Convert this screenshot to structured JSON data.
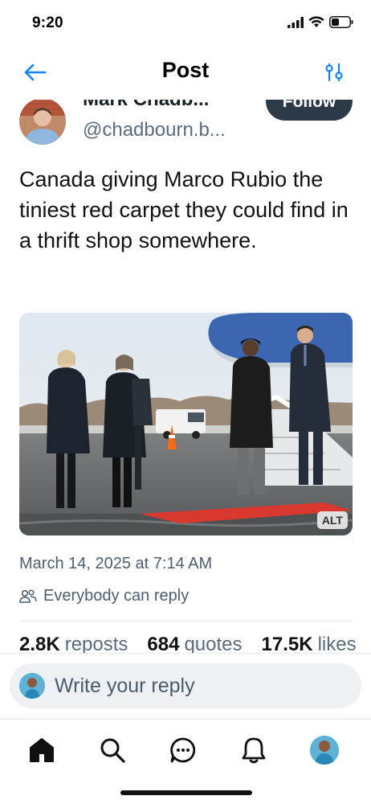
{
  "status_bar": {
    "time": "9:20",
    "icons": [
      "signal-icon",
      "wifi-icon",
      "battery-icon"
    ]
  },
  "header": {
    "title": "Post",
    "back_icon": "arrow-left-icon",
    "filter_icon": "sliders-icon"
  },
  "author": {
    "display_name": "Mark Chadb...",
    "handle": "@chadbourn.b...",
    "follow_label": "Follow"
  },
  "post": {
    "text": "Canada giving Marco Rubio the tiniest red carpet they could find in a thrift shop somewhere.",
    "image_alt_badge": "ALT",
    "date": "March 14, 2025 at 7:14 AM",
    "reply_setting": "Everybody can reply"
  },
  "stats": [
    {
      "count": "2.8K",
      "label": "reposts"
    },
    {
      "count": "684",
      "label": "quotes"
    },
    {
      "count": "17.5K",
      "label": "likes"
    }
  ],
  "reply": {
    "placeholder": "Write your reply"
  },
  "tabs": [
    {
      "name": "home",
      "icon": "home-icon",
      "active": true
    },
    {
      "name": "search",
      "icon": "search-icon",
      "active": false
    },
    {
      "name": "chat",
      "icon": "chat-icon",
      "active": false
    },
    {
      "name": "notifications",
      "icon": "bell-icon",
      "active": false
    },
    {
      "name": "profile",
      "icon": "avatar",
      "active": false
    }
  ],
  "colors": {
    "accent": "#1083fe",
    "follow_bg": "#2c3a48",
    "muted_text": "#4e5e6e",
    "carpet": "#d9382f"
  }
}
